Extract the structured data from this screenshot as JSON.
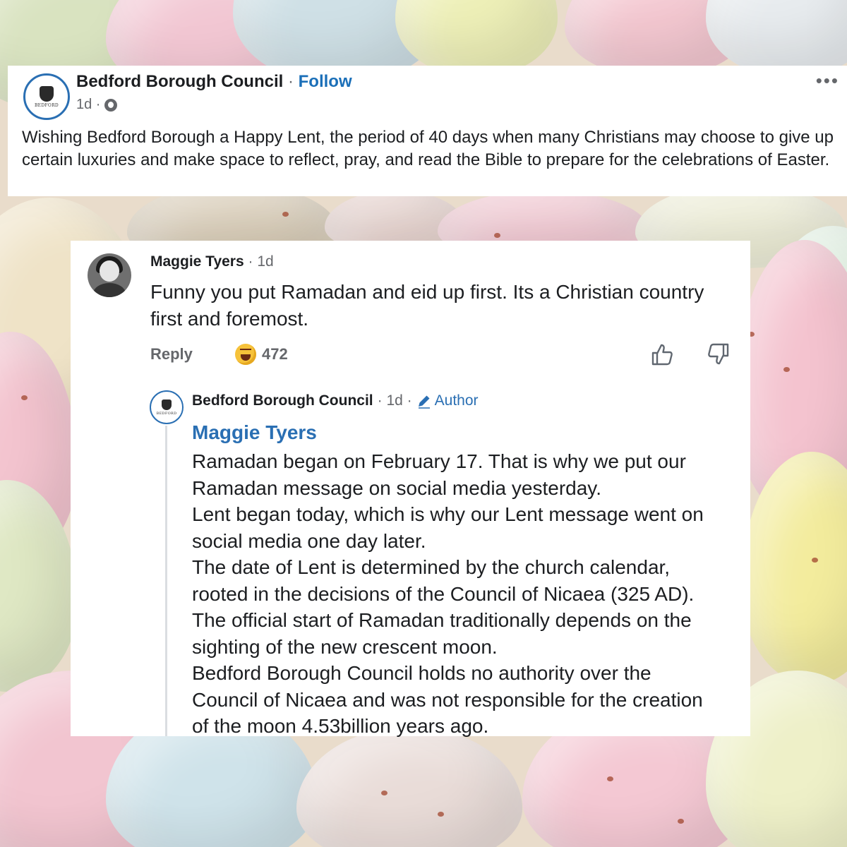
{
  "post": {
    "author": "Bedford Borough Council",
    "separator": "·",
    "follow_label": "Follow",
    "time": "1d ·",
    "more_icon": "more-options-icon",
    "avatar_text": "BEDFORD",
    "body": "Wishing Bedford Borough a Happy Lent, the period of 40 days when many Christians may choose to give up certain luxuries and make space to reflect, pray, and read the Bible to prepare for the celebrations of Easter."
  },
  "comment": {
    "author": "Maggie Tyers",
    "time": "· 1d",
    "text": "Funny you put Ramadan and eid up first.  Its a Christian country first and foremost.",
    "reply_label": "Reply",
    "reaction_icon": "haha-emoji-icon",
    "reaction_count": "472"
  },
  "reply": {
    "author": "Bedford Borough Council",
    "time": "· 1d ·",
    "author_badge": "Author",
    "mention": "Maggie Tyers",
    "lines": [
      "Ramadan began on February 17. That is why we put our",
      "Ramadan message on social media yesterday.",
      "Lent began today, which is why our Lent message went on",
      "social media one day later.",
      "The date of Lent is determined by the church calendar,",
      "rooted in the decisions of the Council of Nicaea (325 AD).",
      "The official start of Ramadan traditionally depends on the",
      "sighting of the new crescent moon.",
      "Bedford Borough Council holds no authority over the",
      "Council of Nicaea and was not responsible for the creation",
      "of the moon 4.53billion years ago."
    ]
  },
  "colors": {
    "link_blue": "#1b6fb8",
    "text": "#1c1e21",
    "muted": "#65676b"
  }
}
